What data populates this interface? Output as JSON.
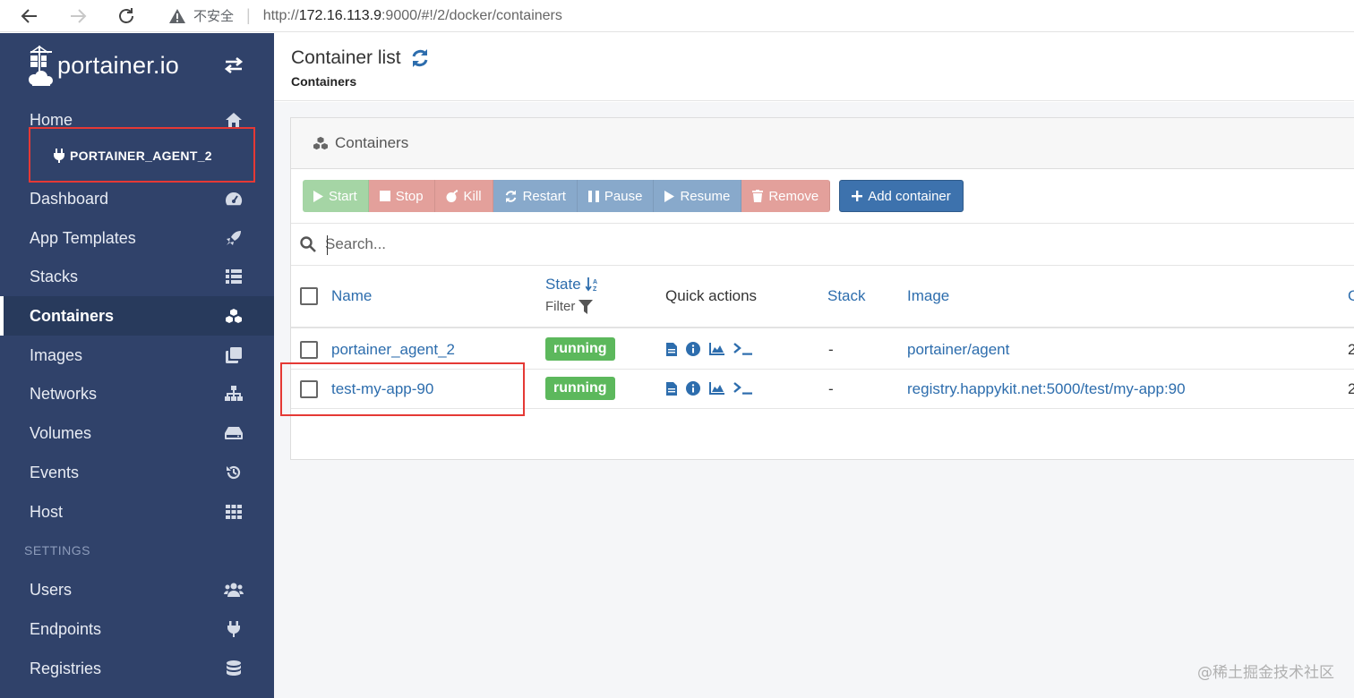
{
  "browser": {
    "back": "←",
    "forward": "→",
    "reload": "↻",
    "security_label": "不安全",
    "url_host": "172.16.113.9",
    "url_prefix": "http://",
    "url_suffix": ":9000/#!/2/docker/containers"
  },
  "sidebar": {
    "brand": "portainer.io",
    "home": "Home",
    "endpoint": "PORTAINER_AGENT_2",
    "items": [
      {
        "label": "Dashboard",
        "icon": "tachometer-icon"
      },
      {
        "label": "App Templates",
        "icon": "rocket-icon"
      },
      {
        "label": "Stacks",
        "icon": "list-icon"
      },
      {
        "label": "Containers",
        "icon": "cubes-icon"
      },
      {
        "label": "Images",
        "icon": "clone-icon"
      },
      {
        "label": "Networks",
        "icon": "sitemap-icon"
      },
      {
        "label": "Volumes",
        "icon": "hdd-icon"
      },
      {
        "label": "Events",
        "icon": "history-icon"
      },
      {
        "label": "Host",
        "icon": "th-icon"
      }
    ],
    "settings_title": "SETTINGS",
    "settings_items": [
      {
        "label": "Users",
        "icon": "users-icon"
      },
      {
        "label": "Endpoints",
        "icon": "plug-icon"
      },
      {
        "label": "Registries",
        "icon": "database-icon"
      }
    ]
  },
  "header": {
    "title": "Container list",
    "breadcrumb": "Containers"
  },
  "widget": {
    "title": "Containers",
    "actions": {
      "start": "Start",
      "stop": "Stop",
      "kill": "Kill",
      "restart": "Restart",
      "pause": "Pause",
      "resume": "Resume",
      "remove": "Remove",
      "add": "Add container"
    },
    "search_placeholder": "Search...",
    "columns": {
      "name": "Name",
      "state": "State",
      "state_filter": "Filter",
      "quick_actions": "Quick actions",
      "stack": "Stack",
      "image": "Image",
      "next": "C"
    },
    "rows": [
      {
        "name": "portainer_agent_2",
        "state": "running",
        "stack": "-",
        "image": "portainer/agent",
        "next": "2"
      },
      {
        "name": "test-my-app-90",
        "state": "running",
        "stack": "-",
        "image": "registry.happykit.net:5000/test/my-app:90",
        "next": "2"
      }
    ]
  },
  "watermark": "@稀土掘金技术社区",
  "colors": {
    "sidebar_bg": "#30426a",
    "link": "#2d6dad",
    "running": "#5cb85c",
    "highlight": "#e53935",
    "primary": "#3d72ad"
  }
}
